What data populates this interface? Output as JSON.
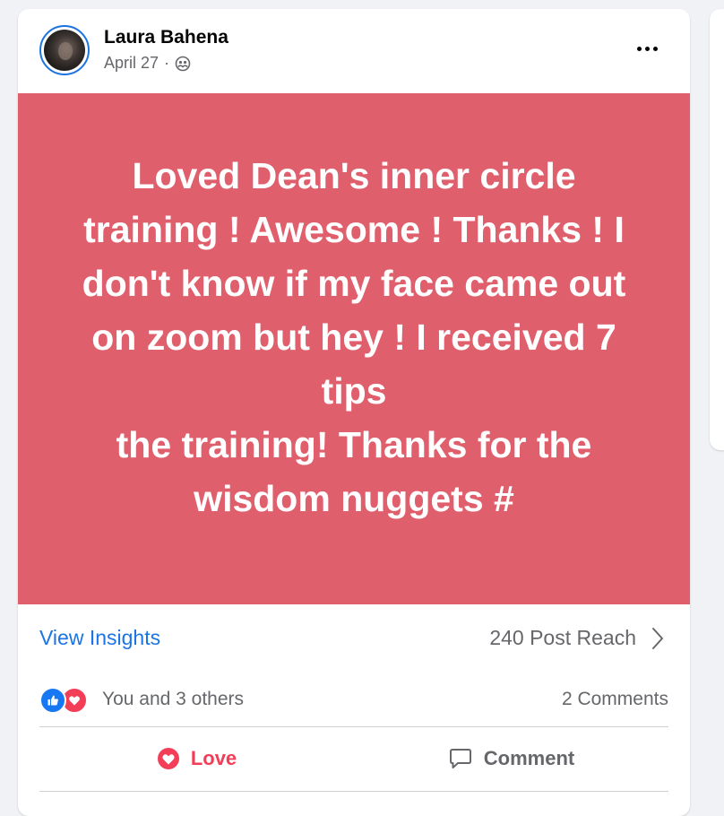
{
  "post": {
    "author": "Laura Bahena",
    "date": "April 27",
    "separator": "·",
    "privacy_icon": "friends-icon",
    "more_icon": "more-horizontal-icon",
    "background_color": "#e05f6c",
    "text": "Loved Dean's inner circle\ntraining ! Awesome ! Thanks ! I\ndon't know if my face came out\non zoom but hey ! I received 7\ntips\nthe training! Thanks for the\nwisdom nuggets #"
  },
  "insights": {
    "link_label": "View Insights",
    "reach_label": "240 Post Reach"
  },
  "reactions": {
    "icons": [
      "like-icon",
      "love-icon"
    ],
    "summary": "You and 3 others",
    "comments": "2 Comments"
  },
  "actions": {
    "love_label": "Love",
    "comment_label": "Comment"
  },
  "colors": {
    "accent": "#1b74e4",
    "love": "#f33e58",
    "like": "#1877f2",
    "muted": "#65676b"
  }
}
